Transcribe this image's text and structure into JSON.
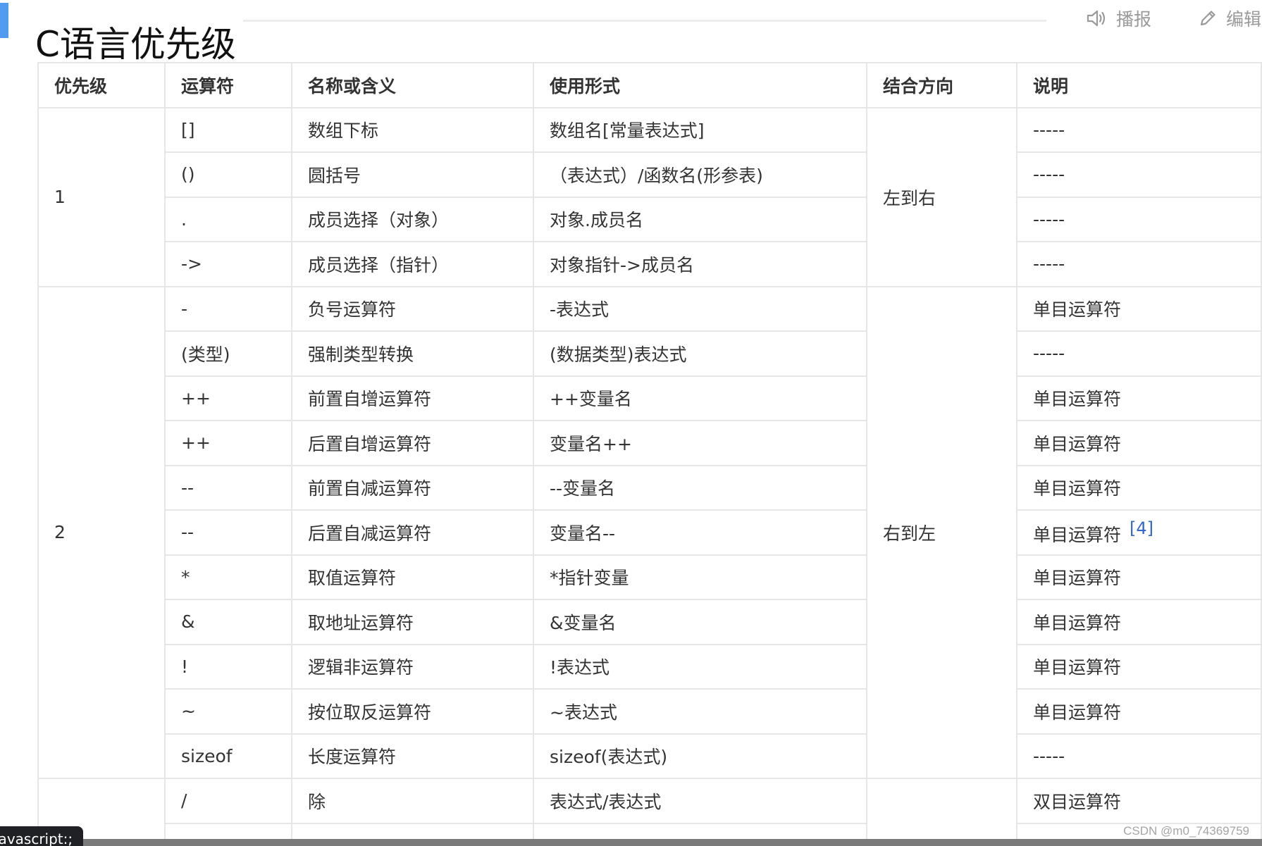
{
  "header": {
    "title": "C语言优先级",
    "listen_label": "播报",
    "edit_label": "编辑"
  },
  "icons": {
    "listen": "speaker-icon",
    "edit": "pencil-icon"
  },
  "colors": {
    "accent": "#4f9cf0",
    "link": "#3366cc",
    "border": "#e6e6e6"
  },
  "table": {
    "headers": [
      "优先级",
      "运算符",
      "名称或含义",
      "使用形式",
      "结合方向",
      "说明"
    ],
    "groups": [
      {
        "priority": "1",
        "direction": "左到右",
        "rows": [
          {
            "op": "[]",
            "name": "数组下标",
            "usage": "数组名[常量表达式]",
            "note": "-----"
          },
          {
            "op": "()",
            "name": "圆括号",
            "usage": "（表达式）/函数名(形参表)",
            "note": "-----"
          },
          {
            "op": ".",
            "name": "成员选择（对象）",
            "usage": "对象.成员名",
            "note": "-----"
          },
          {
            "op": "->",
            "name": "成员选择（指针）",
            "usage": "对象指针->成员名",
            "note": "-----"
          }
        ]
      },
      {
        "priority": "2",
        "direction": "右到左",
        "rows": [
          {
            "op": "-",
            "name": "负号运算符",
            "usage": "-表达式",
            "note": "单目运算符"
          },
          {
            "op": "(类型)",
            "name": "强制类型转换",
            "usage": "(数据类型)表达式",
            "note": "-----"
          },
          {
            "op": "++",
            "name": "前置自增运算符",
            "usage": "++变量名",
            "note": "单目运算符"
          },
          {
            "op": "++",
            "name": "后置自增运算符",
            "usage": "变量名++",
            "note": "单目运算符"
          },
          {
            "op": "--",
            "name": "前置自减运算符",
            "usage": "--变量名",
            "note": "单目运算符"
          },
          {
            "op": "--",
            "name": "后置自减运算符",
            "usage": "变量名--",
            "note": "单目运算符",
            "cite": "[4]"
          },
          {
            "op": "*",
            "name": "取值运算符",
            "usage": "*指针变量",
            "note": "单目运算符"
          },
          {
            "op": "&",
            "name": "取地址运算符",
            "usage": "&变量名",
            "note": "单目运算符"
          },
          {
            "op": "!",
            "name": "逻辑非运算符",
            "usage": "!表达式",
            "note": "单目运算符"
          },
          {
            "op": "~",
            "name": "按位取反运算符",
            "usage": "~表达式",
            "note": "单目运算符"
          },
          {
            "op": "sizeof",
            "name": "长度运算符",
            "usage": "sizeof(表达式)",
            "note": "-----"
          }
        ]
      },
      {
        "priority": "",
        "direction": "",
        "rows": [
          {
            "op": "/",
            "name": "除",
            "usage": "表达式/表达式",
            "note": "双目运算符"
          },
          {
            "op": "",
            "name": "",
            "usage": "",
            "note": ""
          }
        ]
      }
    ]
  },
  "status_bar": {
    "url_text": "javascript:;"
  },
  "watermark": "CSDN @m0_74369759"
}
